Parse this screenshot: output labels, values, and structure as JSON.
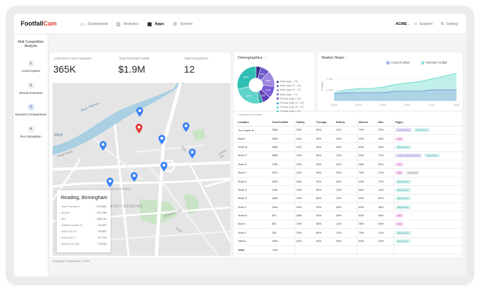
{
  "app": {
    "logo_part1": "Footfall",
    "logo_part2": "Cam"
  },
  "nav": {
    "dashboards": "Dashboards",
    "analytics": "Analytics",
    "apps": "Apps",
    "system": "System"
  },
  "topright": {
    "account": "ACME",
    "support": "Support",
    "setting": "Setting"
  },
  "sidebar": {
    "title": "Mall Competitive Analysis",
    "steps": [
      {
        "num": "1",
        "label": "Control panel"
      },
      {
        "num": "2",
        "label": "Result Overview"
      },
      {
        "num": "3",
        "label": "Scenario Comparisons"
      },
      {
        "num": "4",
        "label": "Run Simulation"
      }
    ]
  },
  "stats": {
    "population_label": "Catchment Area Population",
    "population_value": "365K",
    "footfall_label": "Total Potential Footfall",
    "footfall_value": "$1.9M",
    "competitors_label": "Total Competitors",
    "competitors_value": "12"
  },
  "map": {
    "labels": {
      "river": "River Thames",
      "east": "EAST READING",
      "newtown": "NEWTOWN",
      "thlon": "thlon",
      "kings": "Kings Road",
      "london": "London Rd",
      "a329": "A329",
      "wokingham": "Wokingham Rd",
      "road2": "Road"
    },
    "info": {
      "title": "Reading, Birmingham",
      "rows": [
        {
          "label": "Total Population",
          "value": "~273,991"
        },
        {
          "label": "Women",
          "value": "~137,290"
        },
        {
          "label": "Men",
          "value": "~136,701"
        },
        {
          "label": "Children (under 5)",
          "value": "~19,507"
        },
        {
          "label": "Youth (15-24)",
          "value": "~39,867"
        },
        {
          "label": "Elderly (62+)",
          "value": "~47,718"
        },
        {
          "label": "Women (15-49)",
          "value": "~72,064"
        }
      ]
    }
  },
  "demographics": {
    "title": "Demographics",
    "slices": [
      {
        "label": "Male (Age < 15)",
        "value": 5,
        "color": "#3b2c8f",
        "text": ""
      },
      {
        "label": "Male (Age 15 - 24)",
        "value": 9,
        "color": "#6f59c7",
        "text": "9%"
      },
      {
        "label": "Male (Age 25 - 37)",
        "value": 15,
        "color": "#9c86e0",
        "text": "15%"
      },
      {
        "label": "Male (Age > 37)",
        "value": 12,
        "color": "#7a5bd5",
        "text": "12%"
      },
      {
        "label": "Female (Age < 15)",
        "value": 8,
        "color": "#5a3fb5",
        "text": "8%"
      },
      {
        "label": "Female (Age 15 - 24)",
        "value": 4,
        "color": "#2aa7a1",
        "text": ""
      },
      {
        "label": "Female (Age 25 - 37)",
        "value": 27,
        "color": "#5fd3c9",
        "text": "27%"
      },
      {
        "label": "Female (Age > 37)",
        "value": 32,
        "color": "#2fbfb4",
        "text": "32%"
      }
    ]
  },
  "market": {
    "title": "Market Share",
    "legend_actual": "Actual Footfall",
    "legend_potential": "Potential Footfall",
    "ylabel": "Footfall"
  },
  "chart_data": {
    "type": "area",
    "title": "Market Share",
    "ylabel": "Footfall",
    "xlabel": "",
    "x": [
      2018,
      2019,
      2020,
      2021,
      2022,
      2023
    ],
    "x_ticks": [
      "2018",
      "2019",
      "2020",
      "2021",
      "2022",
      "2023"
    ],
    "y_ticks": [
      "0.8M",
      "1.6M"
    ],
    "ylim": [
      0,
      2.4
    ],
    "series": [
      {
        "name": "Actual Footfall",
        "color": "#6b7fd6",
        "points": [
          [
            2018,
            0.5
          ],
          [
            2018.5,
            0.6
          ],
          [
            2019,
            0.6
          ],
          [
            2019.5,
            0.6
          ],
          [
            2020,
            0.6
          ],
          [
            2020.5,
            0.7
          ],
          [
            2021,
            0.7
          ],
          [
            2021.5,
            0.7
          ],
          [
            2022,
            0.8
          ],
          [
            2022.5,
            0.8
          ],
          [
            2023,
            0.8
          ]
        ]
      },
      {
        "name": "Potential Footfall",
        "color": "#4fd3c4",
        "points": [
          [
            2018,
            0.6
          ],
          [
            2018.5,
            0.8
          ],
          [
            2019,
            0.9
          ],
          [
            2019.5,
            0.9
          ],
          [
            2020,
            1.0
          ],
          [
            2020.5,
            1.2
          ],
          [
            2021,
            1.3
          ],
          [
            2021.5,
            1.4
          ],
          [
            2022,
            1.6
          ],
          [
            2022.5,
            1.8
          ],
          [
            2023,
            2.0
          ]
        ]
      }
    ]
  },
  "competitive": {
    "subtitle": "Competitive Analysis",
    "headers": [
      "Location",
      "Total Footfall",
      "Family",
      "Teenage",
      "Elderly",
      "Women",
      "Men",
      "Tag(s)"
    ],
    "rows": [
      {
        "loc": "The Oracle",
        "star": true,
        "total": "208K",
        "family": "32%",
        "teen": "55%",
        "elderly": "12%",
        "women": "75%",
        "men": "25%",
        "tags": [
          {
            "t": "Luxury Store",
            "c": "purple"
          },
          {
            "t": "Street Store",
            "c": "cyan"
          }
        ]
      },
      {
        "loc": "Mall B",
        "total": "190K",
        "family": "42%",
        "teen": "30%",
        "elderly": "28%",
        "women": "52%",
        "men": "48%",
        "tags": [
          {
            "t": "Mall",
            "c": "pink"
          }
        ]
      },
      {
        "loc": "Store M",
        "total": "188K",
        "family": "42%",
        "teen": "30%",
        "elderly": "28%",
        "women": "60%",
        "men": "40%",
        "tags": [
          {
            "t": "Street Store",
            "c": "cyan"
          }
        ]
      },
      {
        "loc": "Store P",
        "total": "186K",
        "family": "29%",
        "teen": "58%",
        "elderly": "13%",
        "women": "83%",
        "men": "17%",
        "tags": [
          {
            "t": "Leisure & Entertainment",
            "c": "purple"
          },
          {
            "t": "Street Store",
            "c": "cyan"
          }
        ]
      },
      {
        "loc": "Store A",
        "total": "178K",
        "family": "32%",
        "teen": "26%",
        "elderly": "42%",
        "women": "48%",
        "men": "52%",
        "tags": [
          {
            "t": "Mall",
            "c": "pink"
          }
        ]
      },
      {
        "loc": "Store F",
        "total": "157K",
        "family": "42%",
        "teen": "30%",
        "elderly": "28%",
        "women": "79%",
        "men": "21%",
        "tags": [
          {
            "t": "Mall",
            "c": "pink"
          },
          {
            "t": "Food Mall",
            "c": "grey"
          }
        ]
      },
      {
        "loc": "Store D",
        "total": "152K",
        "family": "48%",
        "teen": "32%",
        "elderly": "28%",
        "women": "63%",
        "men": "37%",
        "tags": [
          {
            "t": "Street Store",
            "c": "cyan"
          }
        ]
      },
      {
        "loc": "Store G",
        "total": "114K",
        "family": "29%",
        "teen": "58%",
        "elderly": "13%",
        "women": "86%",
        "men": "14%",
        "tags": [
          {
            "t": "Street Store",
            "c": "cyan"
          }
        ]
      },
      {
        "loc": "Store O",
        "total": "108K",
        "family": "32%",
        "teen": "56%",
        "elderly": "12%",
        "women": "40%",
        "men": "60%",
        "tags": [
          {
            "t": "Street Store",
            "c": "cyan"
          }
        ]
      },
      {
        "loc": "Store C",
        "total": "104K",
        "family": "42%",
        "teen": "30%",
        "elderly": "28%",
        "women": "62%",
        "men": "38%",
        "tags": [
          {
            "t": "Street Store",
            "c": "cyan"
          }
        ]
      },
      {
        "loc": "Store N",
        "total": "87K",
        "family": "38%",
        "teen": "34%",
        "elderly": "28%",
        "women": "50%",
        "men": "50%",
        "tags": [
          {
            "t": "Mall",
            "c": "pink"
          }
        ]
      },
      {
        "loc": "Store I",
        "total": "82K",
        "family": "29%",
        "teen": "58%",
        "elderly": "13%",
        "women": "36%",
        "men": "64%",
        "tags": [
          {
            "t": "Mall",
            "c": "pink"
          }
        ]
      },
      {
        "loc": "Store J",
        "total": "23K",
        "family": "32%",
        "teen": "56%",
        "elderly": "12%",
        "women": "79%",
        "men": "21%",
        "tags": [
          {
            "t": "Street Store",
            "c": "cyan"
          }
        ]
      },
      {
        "loc": "Others",
        "total": "103K",
        "family": "42%",
        "teen": "30%",
        "elderly": "28%",
        "women": "80%",
        "men": "20%",
        "tags": [
          {
            "t": "Street Store",
            "c": "cyan"
          }
        ]
      },
      {
        "loc": "Total",
        "total": "1.9M",
        "family": "",
        "teen": "",
        "elderly": "",
        "women": "",
        "men": "",
        "tags": []
      }
    ]
  },
  "footer": {
    "copyright": "Copyright FootfallCam © 2022"
  },
  "colors": {
    "accent": "#e03c31",
    "pin": "#3b82f6",
    "pin_selected": "#e53935"
  }
}
